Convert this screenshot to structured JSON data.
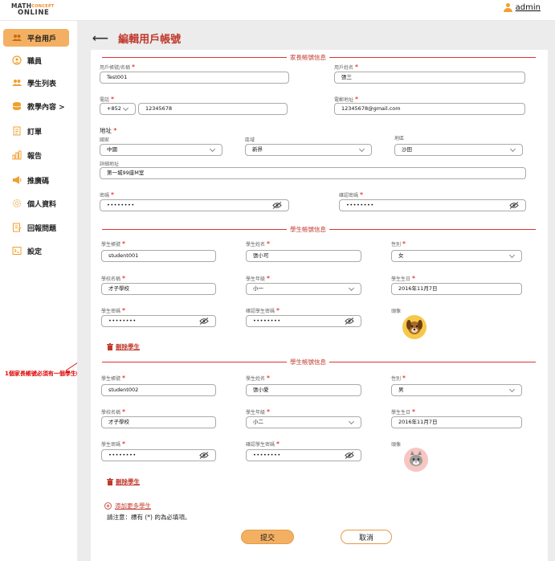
{
  "header": {
    "logo_line1": "MATH",
    "logo_line1b": "CONCEPT",
    "logo_line2": "ONLINE",
    "user_name": "admin",
    "user_icon": "user-icon"
  },
  "sidebar": {
    "items": [
      {
        "label": "平台用戶",
        "icon": "users-icon",
        "active": true
      },
      {
        "label": "職員",
        "icon": "staff-icon"
      },
      {
        "label": "學生列表",
        "icon": "students-icon"
      },
      {
        "label": "教學內容 >",
        "icon": "database-icon"
      },
      {
        "label": "訂單",
        "icon": "order-icon"
      },
      {
        "label": "報告",
        "icon": "chart-icon"
      },
      {
        "label": "推廣碼",
        "icon": "megaphone-icon"
      },
      {
        "label": "個人資料",
        "icon": "gear-icon"
      },
      {
        "label": "回報問題",
        "icon": "report-icon"
      },
      {
        "label": "設定",
        "icon": "settings-icon"
      }
    ]
  },
  "page": {
    "title": "編輯用戶帳號",
    "back_icon": "arrow-left-icon"
  },
  "parent": {
    "section_title": "家長帳號信息",
    "username_label": "用戶帳號/名稱",
    "username_value": "Test001",
    "fullname_label": "用戶姓名",
    "fullname_value": "張三",
    "phone_label": "電話",
    "phone_code": "+852",
    "phone_value": "12345678",
    "email_label": "電郵地址",
    "email_value": "12345678@gmail.com",
    "address_label": "地址",
    "country_label": "國家",
    "country_value": "中國",
    "region_label": "區域",
    "region_value": "新界",
    "district_label": "地區",
    "district_value": "沙田",
    "detail_label": "詳細地址",
    "detail_value": "第一城99座M室",
    "password_label": "密碼",
    "password_value": "••••••••",
    "confirm_label": "確認密碼",
    "confirm_value": "••••••••"
  },
  "students": [
    {
      "section_title": "學生帳號信息",
      "account_label": "學生帳號",
      "account_value": "student001",
      "name_label": "學生姓名",
      "name_value": "張小可",
      "gender_label": "性別",
      "gender_value": "女",
      "school_label": "學校名稱",
      "school_value": "才子學校",
      "grade_label": "學生年級",
      "grade_value": "小一",
      "birthday_label": "學生生日",
      "birthday_value": "2016年11月7日",
      "password_label": "學生密碼",
      "password_value": "••••••••",
      "confirm_label": "確認學生密碼",
      "confirm_value": "••••••••",
      "avatar_label": "頭像",
      "delete_label": "刪除學生"
    },
    {
      "section_title": "學生帳號信息",
      "account_label": "學生帳號",
      "account_value": "student002",
      "name_label": "學生姓名",
      "name_value": "張小愛",
      "gender_label": "性別",
      "gender_value": "男",
      "school_label": "學校名稱",
      "school_value": "才子學校",
      "grade_label": "學生年級",
      "grade_value": "小二",
      "birthday_label": "學生生日",
      "birthday_value": "2016年11月7日",
      "password_label": "學生密碼",
      "password_value": "••••••••",
      "confirm_label": "確認學生密碼",
      "confirm_value": "••••••••",
      "avatar_label": "頭像",
      "delete_label": "刪除學生"
    }
  ],
  "annotation": "1個家長帳號必須有一個學生帳號",
  "add_more_label": "添加更多學生",
  "required_note": "請注意：標有 (*) 的為必填項。",
  "submit_label": "提交",
  "cancel_label": "取消",
  "required_mark": "*",
  "colors": {
    "accent": "#f4b062",
    "heading_red": "#c0392b",
    "background": "#ececec"
  }
}
